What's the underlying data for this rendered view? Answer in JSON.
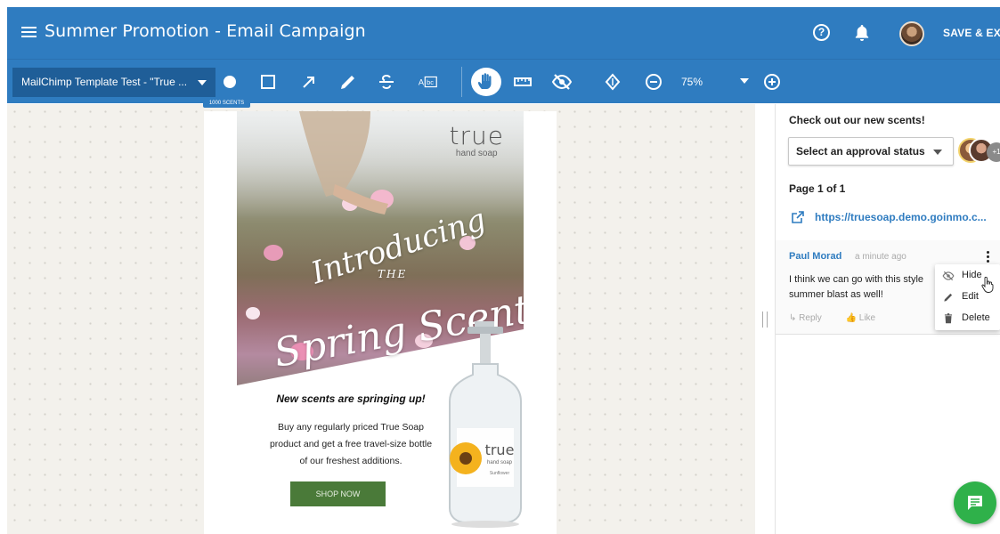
{
  "header": {
    "title": "Summer Promotion - Email Campaign",
    "help_label": "?",
    "save_exit_label": "SAVE & EXIT",
    "brand_color": "#2f7cc0"
  },
  "toolbar": {
    "template_label": "MailChimp Template Test - \"True ...",
    "zoom": "75%",
    "tools": [
      "circle-tool-icon",
      "rectangle-tool-icon",
      "arrow-tool-icon",
      "pencil-tool-icon",
      "strikethrough-tool-icon",
      "text-replace-tool-icon",
      "pan-hand-icon",
      "ruler-icon",
      "hide-markup-icon",
      "rotate-icon",
      "zoom-out-icon",
      "zoom-in-icon"
    ]
  },
  "canvas": {
    "label": "1000 SCENTS",
    "email": {
      "brand": "true",
      "brand_sub": "hand soap",
      "script_1": "Introducing",
      "script_2": "THE",
      "script_3": "Spring Scents",
      "headline": "New scents are springing up!",
      "body_line_1": "Buy any regularly priced True Soap",
      "body_line_2": "product and get a free travel-size bottle",
      "body_line_3": "of our freshest additions.",
      "button": "SHOP NOW",
      "bottle_brand": "true",
      "bottle_sub": "hand soap",
      "bottle_flavor": "Sunflower"
    }
  },
  "panel": {
    "heading": "Check out our new scents!",
    "approval_label": "Select an approval status",
    "more_reviewers": "+1",
    "page_info": "Page 1 of 1",
    "link_text": "https://truesoap.demo.goinmo.c...",
    "comment": {
      "author": "Paul Morad",
      "time": "a minute ago",
      "text": "I think we can go with this style summer blast as well!",
      "reply": "Reply",
      "like": "Like"
    },
    "menu": {
      "hide": "Hide",
      "edit": "Edit",
      "delete": "Delete"
    }
  },
  "fab_icon": "chat-icon",
  "accent_green": "#2fb14a"
}
